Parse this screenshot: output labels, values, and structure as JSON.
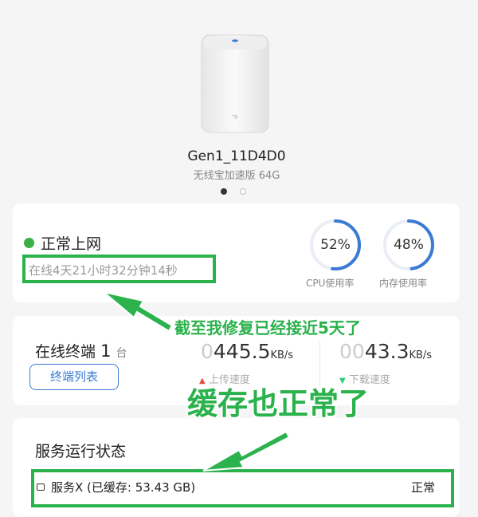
{
  "device": {
    "name": "Gen1_11D4D0",
    "model": "无线宝加速版 64G",
    "pager_total": 2,
    "pager_active": 1
  },
  "network": {
    "status": "正常上网",
    "online_time": "在线4天21小时32分钟14秒",
    "status_color": "#3cb043"
  },
  "usage": {
    "cpu_value": "52%",
    "cpu_percent": 52,
    "cpu_label": "CPU使用率",
    "mem_value": "48%",
    "mem_percent": 48,
    "mem_label": "内存使用率",
    "accent": "#3a7bd5"
  },
  "terminals": {
    "title": "在线终端",
    "count": "1",
    "unit": "台",
    "button_label": "终端列表",
    "upload_lead": "0",
    "upload_value": "445.5",
    "upload_unit": "KB/s",
    "upload_label": "上传速度",
    "download_lead": "00",
    "download_value": "43.3",
    "download_unit": "KB/s",
    "download_label": "下载速度"
  },
  "services": {
    "title": "服务运行状态",
    "items": [
      {
        "name": "服务X (已缓存: 53.43 GB)",
        "status": "正常"
      }
    ]
  },
  "annotations": {
    "note1": "截至我修复已经接近5天了",
    "note2": "缓存也正常了",
    "color": "#2bb24c"
  }
}
